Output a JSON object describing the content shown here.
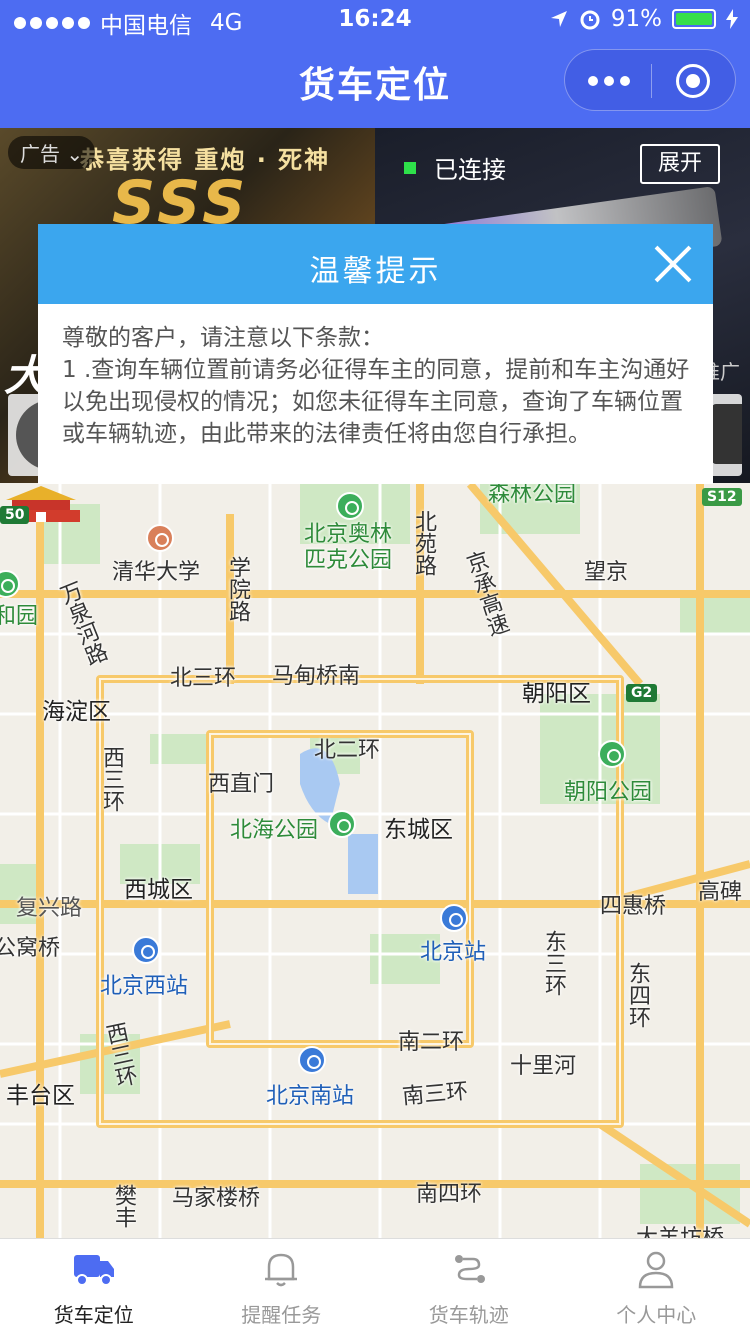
{
  "status_bar": {
    "carrier": "中国电信",
    "network": "4G",
    "time": "16:24",
    "battery": "91%",
    "battery_level": 0.91
  },
  "nav": {
    "title": "货车定位"
  },
  "ad": {
    "tag": "广告",
    "headline": "恭喜获得 重炮 · 死神",
    "rank": "SSS",
    "connection_status": "已连接",
    "expand_label": "展开",
    "corner_char": "大",
    "promo_char": "推广"
  },
  "dialog": {
    "title": "温馨提示",
    "greeting": "尊敬的客户，请注意以下条款：",
    "clause": "1 .查询车辆位置前请务必征得车主的同意，提前和车主沟通好以免出现侵权的情况；如您未征得车主同意，查询了车辆位置或车辆轨迹，由此带来的法律责任将由您自行承担。"
  },
  "map": {
    "labels": {
      "tsinghua": "清华大学",
      "xueyuan_road": "学院路",
      "olympic_park": "北京奥林匹克公园",
      "beiyuan_road": "北苑路",
      "jingcheng_expy": "京承高速",
      "wangjing": "望京",
      "wanquanhe_road": "万泉河路",
      "yuanmingyuan": "和园",
      "senlin_park": "森林公园",
      "north_3rd_ring": "北三环",
      "madian_bridge": "马甸桥南",
      "haidian": "海淀区",
      "chaoyang": "朝阳区",
      "west_3rd_ring": "西三环",
      "north_2nd_ring": "北二环",
      "xizhimen": "西直门",
      "chaoyang_park": "朝阳公园",
      "beihai_park": "北海公园",
      "dongcheng": "东城区",
      "xicheng": "西城区",
      "fuxing_road": "复兴路",
      "gongzhufen": "公窝桥",
      "sihui_bridge": "四惠桥",
      "gaobei": "高碑",
      "beijing_station": "北京站",
      "east_3rd_ring": "东三环",
      "east_4th_ring": "东四环",
      "beijing_west": "北京西站",
      "south_2nd_ring": "南二环",
      "west_3rd_ring_s": "西三环",
      "shilihe": "十里河",
      "fengtai": "丰台区",
      "beijing_south": "北京南站",
      "south_3rd_ring": "南三环",
      "majialou": "马家楼桥",
      "south_4th_ring": "南四环",
      "dayangfang": "大羊坊桥",
      "yifeng": "樊丰"
    },
    "road_badges": {
      "s12": "S12",
      "g2": "G2",
      "left_50": "50"
    }
  },
  "tabbar": {
    "items": [
      {
        "label": "货车定位",
        "icon": "truck-icon",
        "active": true
      },
      {
        "label": "提醒任务",
        "icon": "bell-icon",
        "active": false
      },
      {
        "label": "货车轨迹",
        "icon": "route-icon",
        "active": false
      },
      {
        "label": "个人中心",
        "icon": "person-icon",
        "active": false
      }
    ]
  },
  "colors": {
    "nav_bg": "#4d6cf2",
    "dialog_header": "#3ba6ee",
    "active_tab_icon": "#4d6cf2",
    "connected_dot": "#2ee04a"
  }
}
